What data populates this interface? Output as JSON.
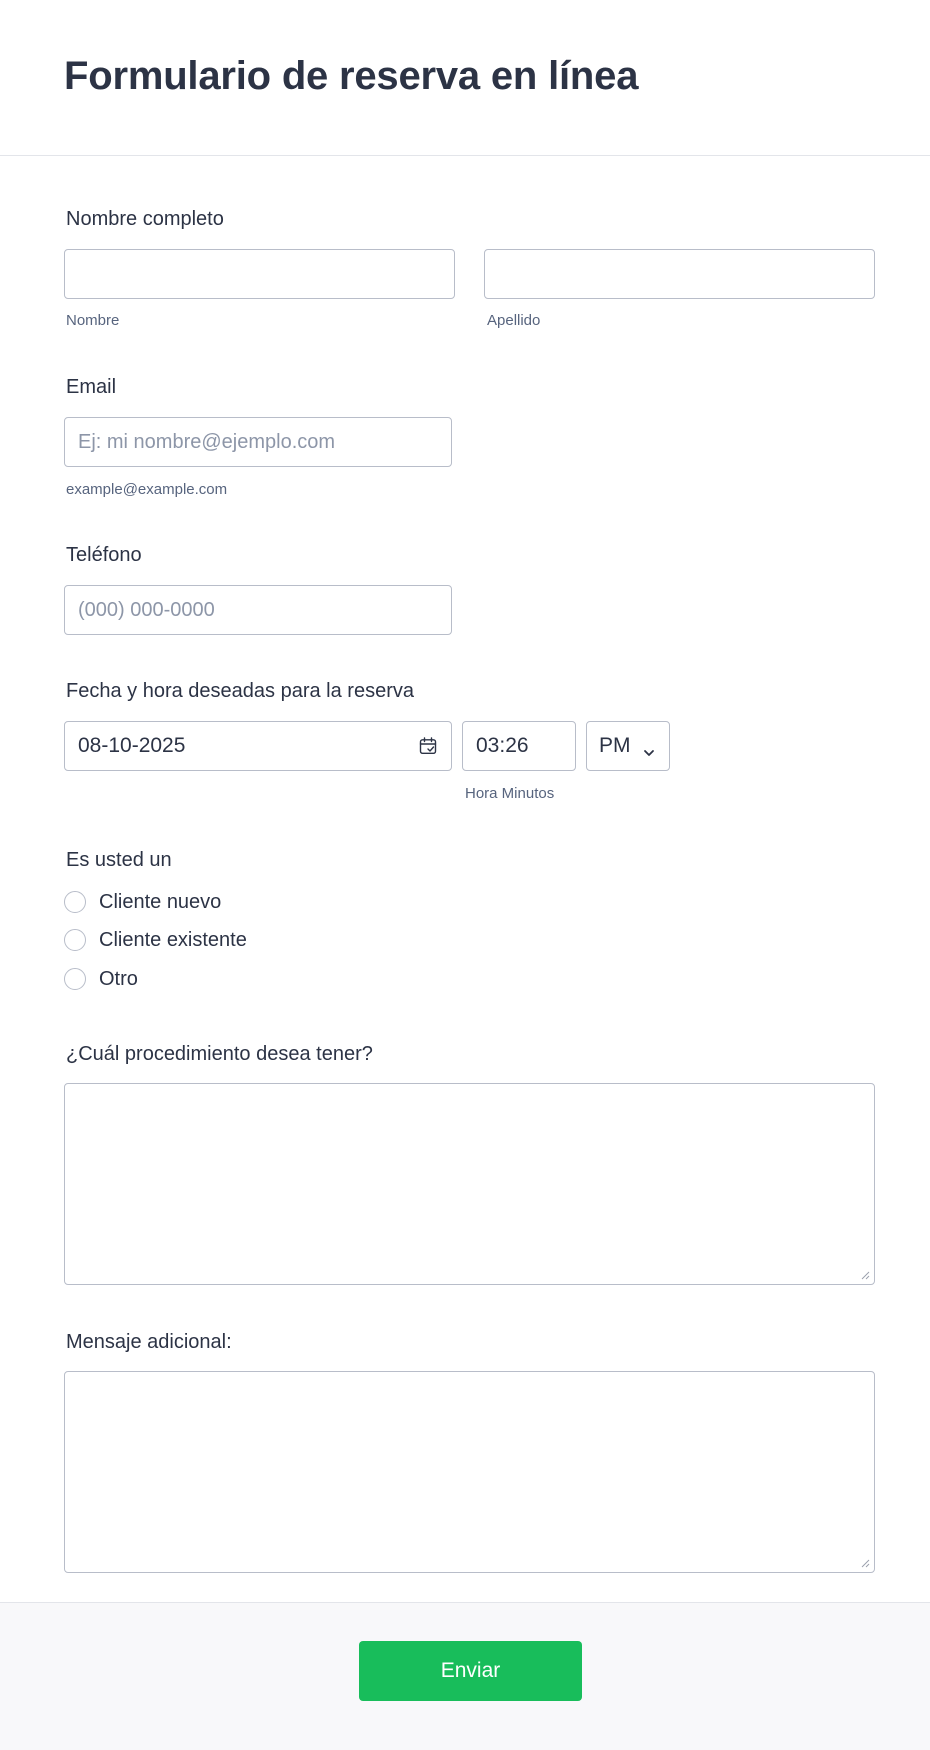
{
  "form": {
    "title": "Formulario de reserva en línea"
  },
  "name_field": {
    "label": "Nombre completo",
    "first_sublabel": "Nombre",
    "last_sublabel": "Apellido",
    "first_value": "",
    "last_value": ""
  },
  "email_field": {
    "label": "Email",
    "placeholder": "Ej: mi nombre@ejemplo.com",
    "value": "",
    "sublabel": "example@example.com"
  },
  "phone_field": {
    "label": "Teléfono",
    "placeholder": "(000) 000-0000",
    "value": ""
  },
  "datetime_field": {
    "label": "Fecha y hora deseadas para la reserva",
    "date_value": "08-10-2025",
    "date_icon": "calendar-icon",
    "time_value": "03:26",
    "ampm_value": "PM",
    "time_sublabel": "Hora Minutos"
  },
  "customer_type": {
    "label": "Es usted un",
    "options": [
      {
        "label": "Cliente nuevo"
      },
      {
        "label": "Cliente existente"
      },
      {
        "label": "Otro"
      }
    ]
  },
  "procedure_field": {
    "label": "¿Cuál procedimiento desea tener?",
    "value": ""
  },
  "message_field": {
    "label": "Mensaje adicional:",
    "value": ""
  },
  "submit": {
    "label": "Enviar"
  },
  "colors": {
    "text": "#2c3345",
    "sublabel": "#57647e",
    "border": "#b8bdc9",
    "submit_bg": "#18bd5b",
    "footer_bg": "#f8f8fa"
  }
}
